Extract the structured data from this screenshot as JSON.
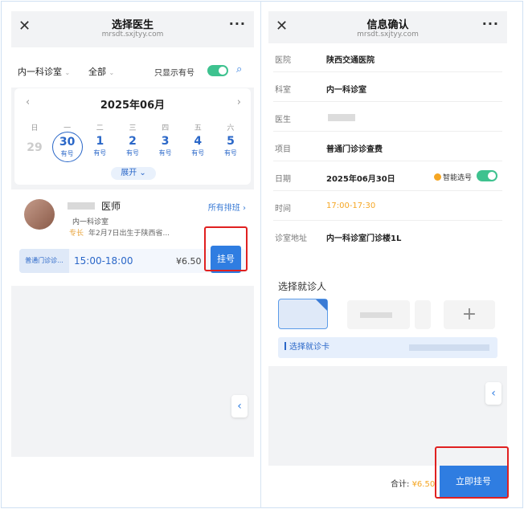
{
  "left_screen": {
    "title": "选择医生",
    "subtitle": "mrsdt.sxjtyy.com",
    "close_icon": "close-icon",
    "more_icon": "more-icon",
    "filters": {
      "department": "内一科诊室",
      "scope": "全部",
      "only_available_label": "只显示有号",
      "only_available_on": true
    },
    "calendar": {
      "month": "2025年06月",
      "weekdays": [
        "日",
        "一",
        "二",
        "三",
        "四",
        "五",
        "六"
      ],
      "days": [
        {
          "num": "29",
          "status": ""
        },
        {
          "num": "30",
          "status": "有号"
        },
        {
          "num": "1",
          "status": "有号"
        },
        {
          "num": "2",
          "status": "有号"
        },
        {
          "num": "3",
          "status": "有号"
        },
        {
          "num": "4",
          "status": "有号"
        },
        {
          "num": "5",
          "status": "有号"
        }
      ],
      "selected_day": "30",
      "expand_label": "展开"
    },
    "doctor": {
      "title": "医师",
      "department": "内一科诊室",
      "all_schedules": "所有排班",
      "specialty_label": "专长",
      "specialty_text": "年2月7日出生于陕西省...",
      "slot": {
        "type": "普通门诊诊...",
        "time": "15:00-18:00",
        "price": "¥6.50",
        "register_label": "挂号"
      }
    },
    "side_arrow": "‹"
  },
  "right_screen": {
    "title": "信息确认",
    "subtitle": "mrsdt.sxjtyy.com",
    "rows": [
      {
        "label": "医院",
        "value": "陕西交通医院"
      },
      {
        "label": "科室",
        "value": "内一科诊室"
      },
      {
        "label": "医生",
        "value": ""
      },
      {
        "label": "项目",
        "value": "普通门诊诊查费"
      },
      {
        "label": "日期",
        "value": "2025年06月30日"
      },
      {
        "label": "时间",
        "value": "17:00-17:30"
      },
      {
        "label": "诊室地址",
        "value": "内一科诊室门诊楼1L"
      }
    ],
    "smart_select_label": "智能选号",
    "smart_select_on": true,
    "patient": {
      "section_title": "选择就诊人",
      "add_symbol": "+",
      "select_card_label": "选择就诊卡"
    },
    "footer": {
      "total_label": "合计:",
      "total_value": "¥6.50",
      "register_now": "立即挂号"
    },
    "side_arrow": "‹"
  },
  "colors": {
    "primary": "#2f7de1",
    "accent_orange": "#f5a623",
    "toggle_green": "#3ec28f",
    "highlight_red": "#e02020"
  }
}
